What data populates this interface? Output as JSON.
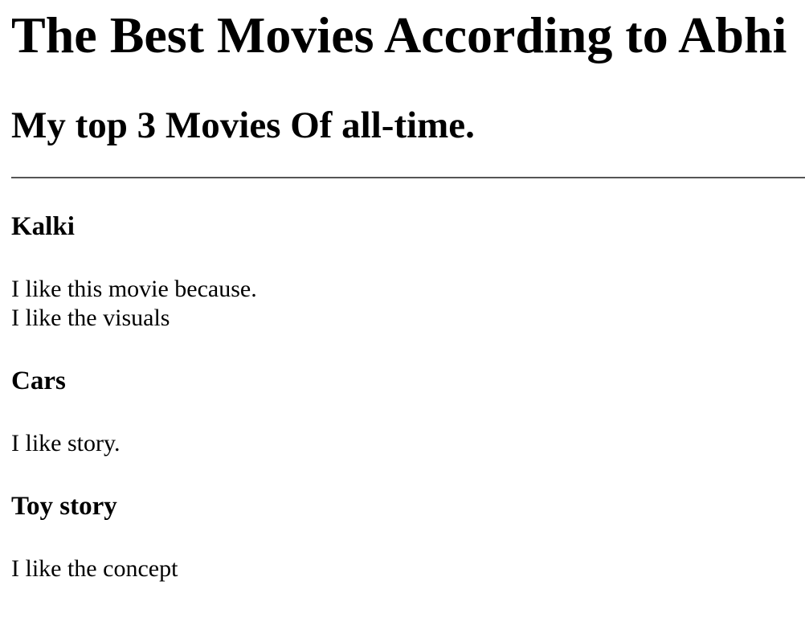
{
  "page": {
    "title": "The Best Movies According to Abhi",
    "subtitle": "My top 3 Movies Of all-time."
  },
  "movies": [
    {
      "name": "Kalki",
      "reason_lines": [
        "I like this movie because.",
        "I like the visuals"
      ]
    },
    {
      "name": "Cars",
      "reason_lines": [
        "I like story."
      ]
    },
    {
      "name": "Toy story",
      "reason_lines": [
        "I like the concept"
      ]
    }
  ]
}
